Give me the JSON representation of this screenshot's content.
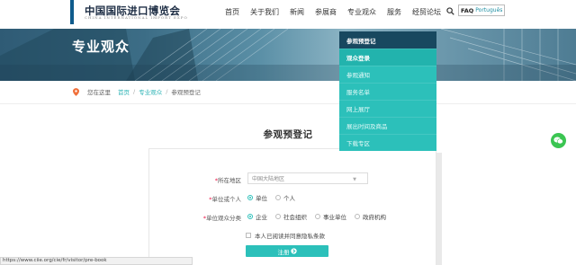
{
  "header": {
    "logo_text": "中国国际进口博览会",
    "logo_sub": "CHINA INTERNATIONAL IMPORT EXPO",
    "nav": [
      "首页",
      "关于我们",
      "新闻",
      "参展商",
      "专业观众",
      "服务",
      "经贸论坛"
    ],
    "lang_faq": "FAQ",
    "lang_pt": "Português"
  },
  "banner": {
    "title": "专业观众"
  },
  "breadcrumb": {
    "prefix": "您在这里",
    "home": "首页",
    "section": "专业观众",
    "current": "参观预登记"
  },
  "dropdown": {
    "head": "参观预登记",
    "items": [
      "观众登录",
      "参观通知",
      "服务名单",
      "网上展厅",
      "展出时间及商品",
      "下载专区"
    ],
    "active_index": 0
  },
  "form": {
    "title": "参观预登记",
    "region_label": "所在地区",
    "region_value": "中国大陆地区",
    "type_label": "单位或个人",
    "type_options": [
      "单位",
      "个人"
    ],
    "type_selected": 0,
    "category_label": "单位观众分类",
    "category_options": [
      "企业",
      "社会组织",
      "事业单位",
      "政府机构"
    ],
    "category_selected": 0,
    "agree_text": "本人已阅读并同意隐私条款",
    "submit_label": "注册"
  },
  "status_url": "https://www.ciie.org/cie/fr/visitor/pre-book",
  "colors": {
    "accent": "#2cc0ba",
    "dropdown_head": "#18485f",
    "brand": "#0f5b8c",
    "wechat": "#3bc552"
  }
}
